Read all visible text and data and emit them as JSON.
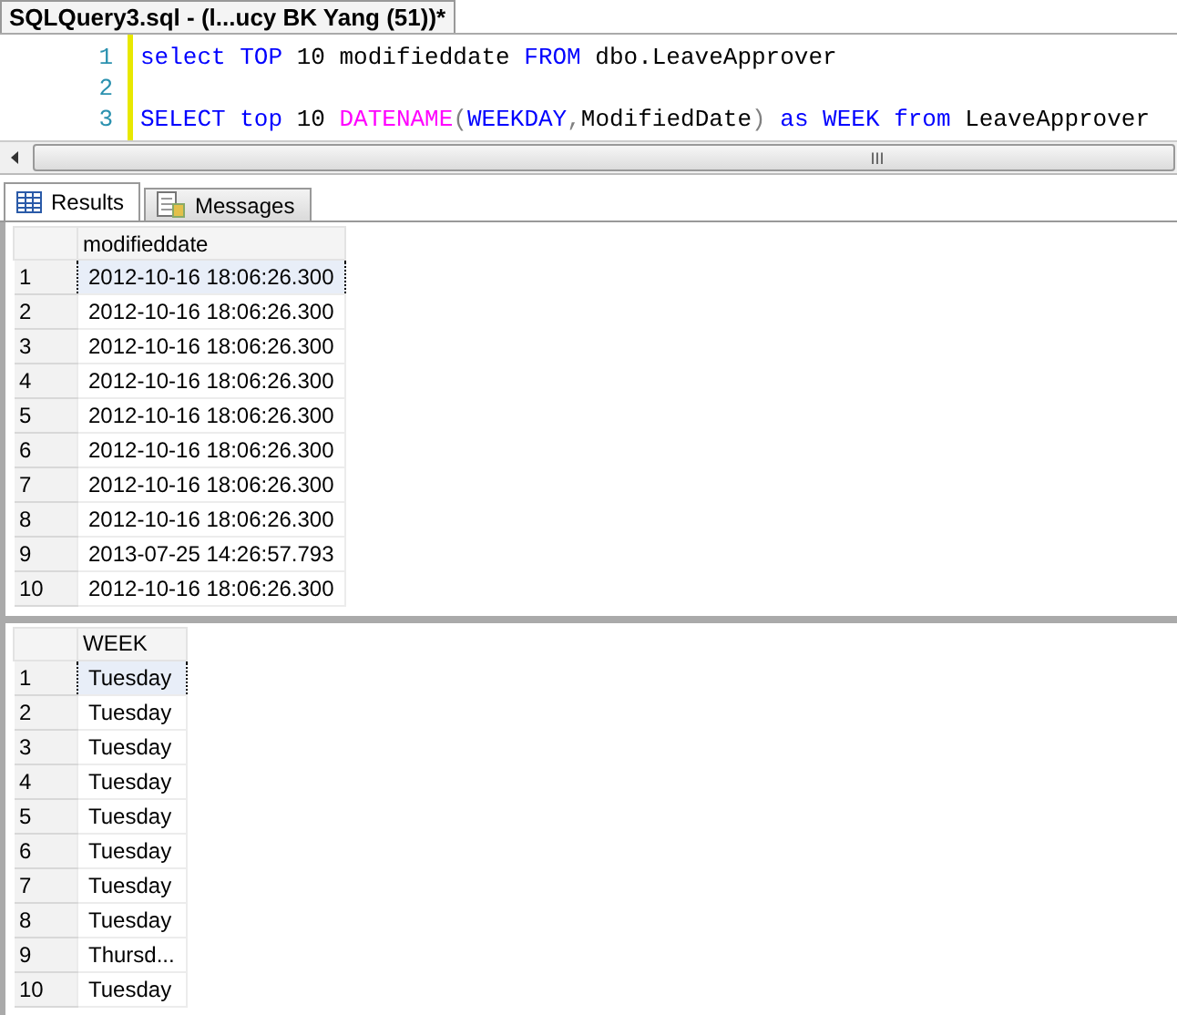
{
  "document_tab": {
    "title": "SQLQuery3.sql - (l...ucy BK Yang (51))*"
  },
  "editor": {
    "lines": [
      {
        "number": "1",
        "tokens": [
          {
            "text": "select",
            "kind": "keyword"
          },
          {
            "text": " TOP",
            "kind": "keyword"
          },
          {
            "text": " 10 modifieddate ",
            "kind": "plain"
          },
          {
            "text": "FROM",
            "kind": "keyword"
          },
          {
            "text": " dbo.LeaveApprover",
            "kind": "plain"
          }
        ]
      },
      {
        "number": "2"
      },
      {
        "number": "3",
        "tokens": [
          {
            "text": "SELECT",
            "kind": "keyword"
          },
          {
            "text": " top",
            "kind": "keyword"
          },
          {
            "text": " 10 ",
            "kind": "plain"
          },
          {
            "text": "DATENAME",
            "kind": "function"
          },
          {
            "text": "(",
            "kind": "operator"
          },
          {
            "text": "WEEKDAY",
            "kind": "keyword"
          },
          {
            "text": ",",
            "kind": "operator"
          },
          {
            "text": "ModifiedDate",
            "kind": "plain"
          },
          {
            "text": ")",
            "kind": "operator"
          },
          {
            "text": " as",
            "kind": "keyword"
          },
          {
            "text": " WEEK",
            "kind": "keyword"
          },
          {
            "text": " from",
            "kind": "keyword"
          },
          {
            "text": " LeaveApprover",
            "kind": "plain"
          }
        ]
      }
    ],
    "scroll_grip": "III"
  },
  "result_tabs": [
    {
      "label": "Results",
      "selected": true
    },
    {
      "label": "Messages",
      "selected": false
    }
  ],
  "grids": [
    {
      "column": "modifieddate",
      "rows": [
        {
          "number": "1",
          "value": "2012-10-16 18:06:26.300",
          "selected": true
        },
        {
          "number": "2",
          "value": "2012-10-16 18:06:26.300",
          "selected": false
        },
        {
          "number": "3",
          "value": "2012-10-16 18:06:26.300",
          "selected": false
        },
        {
          "number": "4",
          "value": "2012-10-16 18:06:26.300",
          "selected": false
        },
        {
          "number": "5",
          "value": "2012-10-16 18:06:26.300",
          "selected": false
        },
        {
          "number": "6",
          "value": "2012-10-16 18:06:26.300",
          "selected": false
        },
        {
          "number": "7",
          "value": "2012-10-16 18:06:26.300",
          "selected": false
        },
        {
          "number": "8",
          "value": "2012-10-16 18:06:26.300",
          "selected": false
        },
        {
          "number": "9",
          "value": "2013-07-25 14:26:57.793",
          "selected": false
        },
        {
          "number": "10",
          "value": "2012-10-16 18:06:26.300",
          "selected": false
        }
      ]
    },
    {
      "column": "WEEK",
      "rows": [
        {
          "number": "1",
          "value": "Tuesday",
          "selected": true
        },
        {
          "number": "2",
          "value": "Tuesday",
          "selected": false
        },
        {
          "number": "3",
          "value": "Tuesday",
          "selected": false
        },
        {
          "number": "4",
          "value": "Tuesday",
          "selected": false
        },
        {
          "number": "5",
          "value": "Tuesday",
          "selected": false
        },
        {
          "number": "6",
          "value": "Tuesday",
          "selected": false
        },
        {
          "number": "7",
          "value": "Tuesday",
          "selected": false
        },
        {
          "number": "8",
          "value": "Tuesday",
          "selected": false
        },
        {
          "number": "9",
          "value": "Thursd...",
          "selected": false
        },
        {
          "number": "10",
          "value": "Tuesday",
          "selected": false
        }
      ]
    }
  ]
}
